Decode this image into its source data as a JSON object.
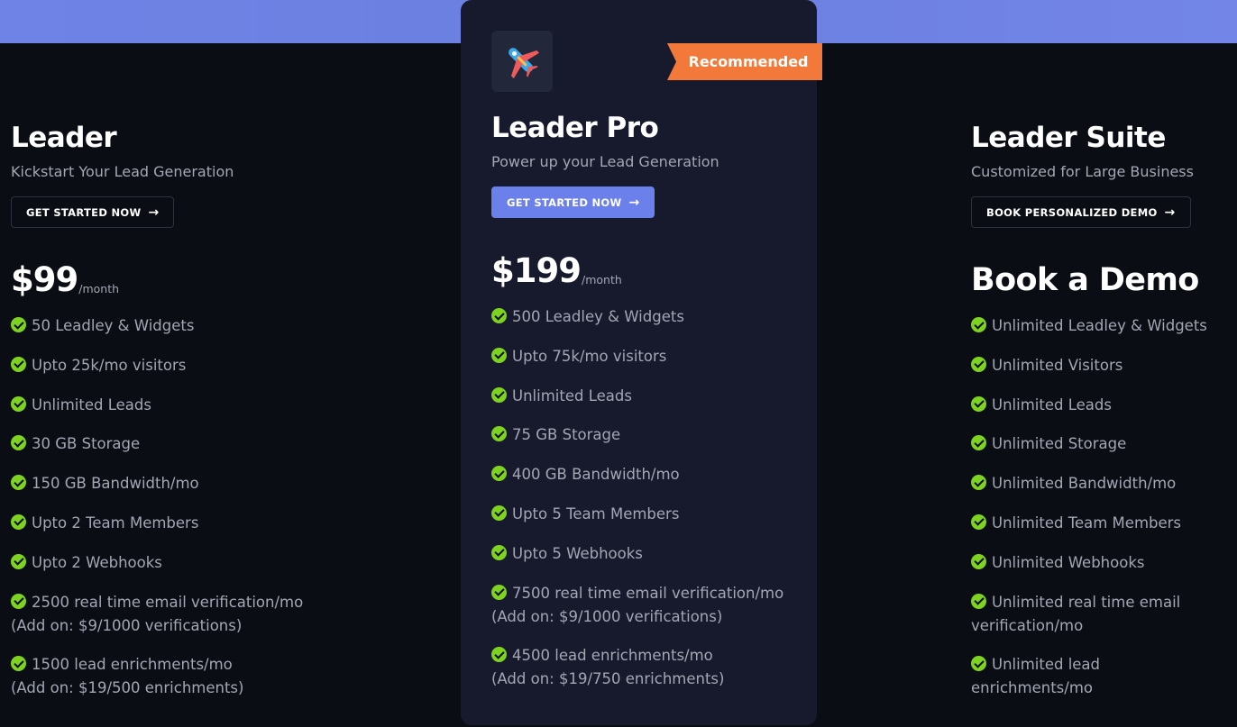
{
  "colors": {
    "accent": "#6b80ea",
    "ribbon": "#f2793a",
    "check": "#7ed321",
    "background": "#0b0d14",
    "card": "#161a2c"
  },
  "plans": {
    "leader": {
      "name": "Leader",
      "tagline": "Kickstart Your Lead Generation",
      "cta_label": "GET STARTED NOW",
      "price": "$99",
      "period": "/month",
      "features": [
        "50 Leadley & Widgets",
        "Upto 25k/mo visitors",
        "Unlimited Leads",
        "30 GB Storage",
        "150 GB Bandwidth/mo",
        "Upto 2 Team Members",
        "Upto 2 Webhooks",
        "2500 real time email verification/mo",
        "1500 lead enrichments/mo"
      ],
      "addons": {
        "verification": "(Add on: $9/1000 verifications)",
        "enrichment": "(Add on: $19/500 enrichments)"
      }
    },
    "pro": {
      "badge": "Recommended",
      "icon": "airplane-icon",
      "name": "Leader Pro",
      "tagline": "Power up your Lead Generation",
      "cta_label": "GET STARTED NOW",
      "price": "$199",
      "period": "/month",
      "features": [
        "500 Leadley & Widgets",
        "Upto 75k/mo visitors",
        "Unlimited Leads",
        "75 GB Storage",
        "400 GB Bandwidth/mo",
        "Upto 5 Team Members",
        "Upto 5 Webhooks",
        "7500 real time email verification/mo",
        "4500 lead enrichments/mo"
      ],
      "addons": {
        "verification": "(Add on: $9/1000 verifications)",
        "enrichment": "(Add on: $19/750 enrichments)"
      }
    },
    "suite": {
      "name": "Leader Suite",
      "tagline": "Customized for Large Business",
      "cta_label": "BOOK PERSONALIZED DEMO",
      "price_heading": "Book a Demo",
      "features": [
        "Unlimited Leadley & Widgets",
        "Unlimited Visitors",
        "Unlimited Leads",
        "Unlimited Storage",
        "Unlimited Bandwidth/mo",
        "Unlimited Team Members",
        "Unlimited Webhooks",
        "Unlimited real time email",
        "verification/mo",
        "Unlimited lead",
        "enrichments/mo"
      ]
    }
  }
}
